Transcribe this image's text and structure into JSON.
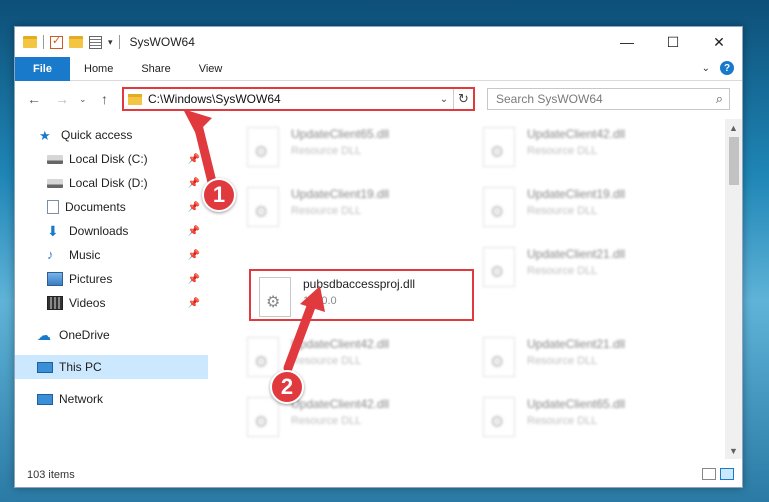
{
  "window": {
    "title": "SysWOW64",
    "controls": {
      "minimize": "—",
      "maximize": "☐",
      "close": "✕"
    }
  },
  "ribbon": {
    "tabs": [
      "File",
      "Home",
      "Share",
      "View"
    ],
    "help": "?"
  },
  "address": {
    "path": "C:\\Windows\\SysWOW64",
    "search_placeholder": "Search SysWOW64"
  },
  "sidebar": {
    "items": [
      {
        "label": "Quick access",
        "icon": "star-icon"
      },
      {
        "label": "Local Disk (C:)",
        "icon": "disk-icon",
        "pinned": true
      },
      {
        "label": "Local Disk (D:)",
        "icon": "disk-icon",
        "pinned": true
      },
      {
        "label": "Documents",
        "icon": "documents-icon",
        "pinned": true
      },
      {
        "label": "Downloads",
        "icon": "downloads-icon",
        "pinned": true
      },
      {
        "label": "Music",
        "icon": "music-icon",
        "pinned": true
      },
      {
        "label": "Pictures",
        "icon": "pictures-icon",
        "pinned": true
      },
      {
        "label": "Videos",
        "icon": "videos-icon",
        "pinned": true
      },
      {
        "label": "OneDrive",
        "icon": "onedrive-icon"
      },
      {
        "label": "This PC",
        "icon": "this-pc-icon",
        "selected": true
      },
      {
        "label": "Network",
        "icon": "network-icon"
      }
    ]
  },
  "files": [
    {
      "name": "UpdateClient65.dll",
      "type": "Resource DLL"
    },
    {
      "name": "UpdateClient42.dll",
      "type": "Resource DLL"
    },
    {
      "name": "UpdateClient19.dll",
      "type": "Resource DLL"
    },
    {
      "name": "UpdateClient19.dll",
      "type": "Resource DLL"
    },
    {
      "name": "pubsdbaccessproj.dll",
      "type": "1.0.0.0",
      "highlighted": true
    },
    {
      "name": "UpdateClient21.dll",
      "type": "Resource DLL"
    },
    {
      "name": "UpdateClient42.dll",
      "type": "Resource DLL"
    },
    {
      "name": "UpdateClient21.dll",
      "type": "Resource DLL"
    },
    {
      "name": "UpdateClient42.dll",
      "type": "Resource DLL"
    },
    {
      "name": "UpdateClient65.dll",
      "type": "Resource DLL"
    }
  ],
  "status": {
    "item_count": "103 items"
  },
  "annotations": {
    "step1": "1",
    "step2": "2",
    "color": "#e0393e"
  }
}
